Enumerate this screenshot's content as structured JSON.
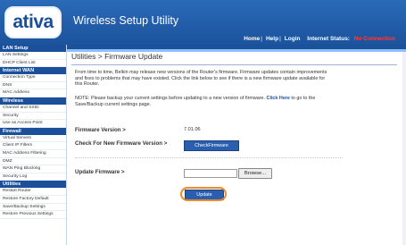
{
  "header": {
    "logo_text": "ativa",
    "app_title": "Wireless Setup Utility",
    "nav": {
      "home": "Home",
      "help": "Help",
      "login": "Login",
      "status_label": "Internet Status:",
      "status_value": "No Connection"
    }
  },
  "sidebar": [
    {
      "heading": "LAN Setup",
      "items": [
        "LAN Settings",
        "DHCP Client List"
      ]
    },
    {
      "heading": "Internet WAN",
      "items": [
        "Connection Type",
        "DNS",
        "MAC Address"
      ]
    },
    {
      "heading": "Wireless",
      "items": [
        "Channel and SSID",
        "Security",
        "Use as Access Point"
      ]
    },
    {
      "heading": "Firewall",
      "items": [
        "Virtual Servers",
        "Client IP Filters",
        "MAC Address Filtering",
        "DMZ",
        "WAN Ping Blocking",
        "Security Log"
      ]
    },
    {
      "heading": "Utilities",
      "items": [
        "Restart Router",
        "Restore Factory Default",
        "Save/Backup Settings",
        "Restore Previous Settings"
      ]
    }
  ],
  "main": {
    "title": "Utilities > Firmware Update",
    "intro": "From time to time, Belkin may release new versions of the Router's firmware. Firmware updates contain improvements and fixes to problems that may have existed. Click the link below to see if there is a new firmware update available for this Router.",
    "note_prefix": "NOTE: Please backup your current settings before updating to a new version of firmware.",
    "note_link": "Click Here",
    "note_suffix": "to go to the Save/Backup current settings page.",
    "firmware_version_label": "Firmware Version >",
    "firmware_version_value": "7.01.06",
    "check_label": "Check For New Firmware Version >",
    "check_button": "CheckFirmware",
    "update_label": "Update Firmware >",
    "browse_button": "Browse...",
    "update_button": "Update",
    "file_value": ""
  },
  "colors": {
    "header_bg": "#1a4f98",
    "status_red": "#ff3b3b",
    "highlight_orange": "#f08a24",
    "button_blue": "#2a5fb0"
  }
}
